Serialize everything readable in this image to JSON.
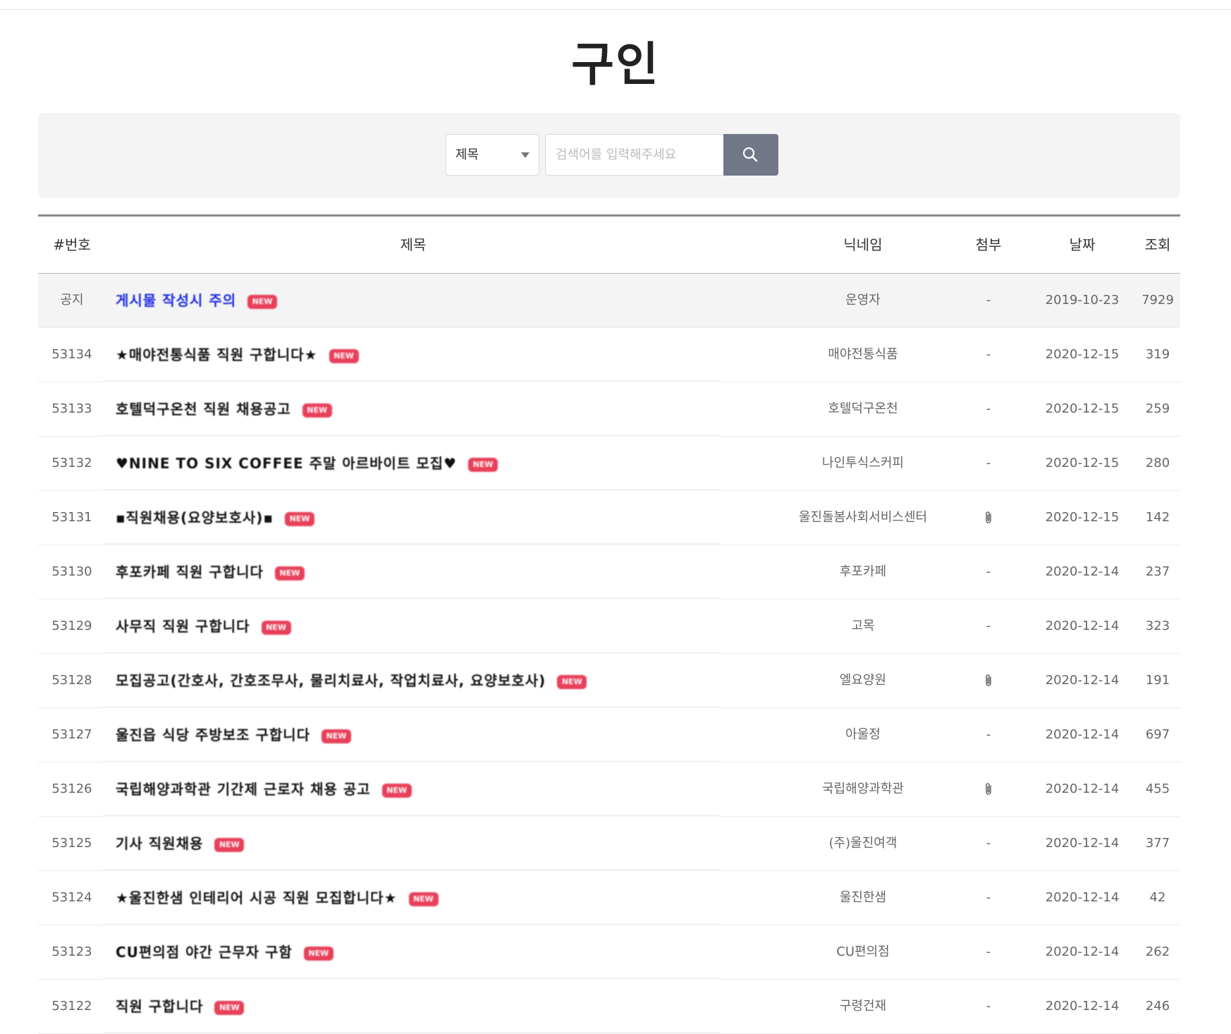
{
  "page": {
    "title": "구인"
  },
  "search": {
    "select_value": "제목",
    "placeholder": "검색어를 입력해주세요"
  },
  "columns": {
    "no": "#번호",
    "title": "제목",
    "nickname": "닉네임",
    "attach": "첨부",
    "date": "날짜",
    "views": "조회"
  },
  "badge_text": "NEW",
  "rows": [
    {
      "no": "공지",
      "title": "게시물 작성시 주의",
      "nickname": "운영자",
      "attach": "-",
      "date": "2019-10-23",
      "views": "7929",
      "notice": true
    },
    {
      "no": "53134",
      "title": "★매야전통식품 직원 구합니다★",
      "nickname": "매야전통식품",
      "attach": "-",
      "date": "2020-12-15",
      "views": "319"
    },
    {
      "no": "53133",
      "title": "호텔덕구온천 직원 채용공고",
      "nickname": "호텔덕구온천",
      "attach": "-",
      "date": "2020-12-15",
      "views": "259"
    },
    {
      "no": "53132",
      "title": "♥NINE TO SIX COFFEE 주말 아르바이트 모집♥",
      "nickname": "나인투식스커피",
      "attach": "-",
      "date": "2020-12-15",
      "views": "280"
    },
    {
      "no": "53131",
      "title": "▪직원채용(요양보호사)▪",
      "nickname": "울진돌봄사회서비스센터",
      "attach": "clip",
      "date": "2020-12-15",
      "views": "142"
    },
    {
      "no": "53130",
      "title": "후포카페 직원 구합니다",
      "nickname": "후포카페",
      "attach": "-",
      "date": "2020-12-14",
      "views": "237"
    },
    {
      "no": "53129",
      "title": "사무직 직원 구합니다",
      "nickname": "고목",
      "attach": "-",
      "date": "2020-12-14",
      "views": "323"
    },
    {
      "no": "53128",
      "title": "모집공고(간호사, 간호조무사, 물리치료사, 작업치료사, 요양보호사)",
      "nickname": "엘요양원",
      "attach": "clip",
      "date": "2020-12-14",
      "views": "191"
    },
    {
      "no": "53127",
      "title": "울진읍 식당 주방보조 구합니다",
      "nickname": "아울정",
      "attach": "-",
      "date": "2020-12-14",
      "views": "697"
    },
    {
      "no": "53126",
      "title": "국립해양과학관 기간제 근로자 채용 공고",
      "nickname": "국립해양과학관",
      "attach": "clip",
      "date": "2020-12-14",
      "views": "455"
    },
    {
      "no": "53125",
      "title": "기사 직원채용",
      "nickname": "(주)울진여객",
      "attach": "-",
      "date": "2020-12-14",
      "views": "377"
    },
    {
      "no": "53124",
      "title": "★울진한샘 인테리어 시공 직원 모집합니다★",
      "nickname": "울진한샘",
      "attach": "-",
      "date": "2020-12-14",
      "views": "42"
    },
    {
      "no": "53123",
      "title": "CU편의점 야간 근무자 구함",
      "nickname": "CU편의점",
      "attach": "-",
      "date": "2020-12-14",
      "views": "262"
    },
    {
      "no": "53122",
      "title": "직원 구합니다",
      "nickname": "구령건재",
      "attach": "-",
      "date": "2020-12-14",
      "views": "246"
    }
  ]
}
